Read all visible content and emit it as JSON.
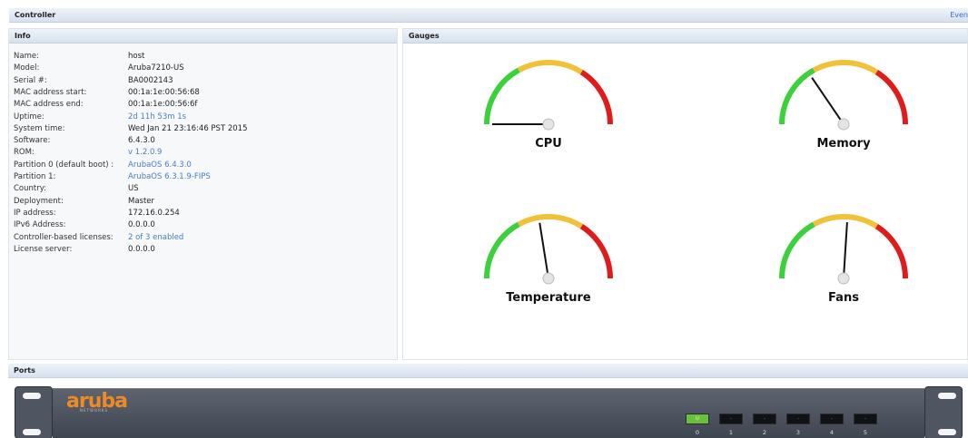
{
  "header": {
    "title": "Controller",
    "events_link": "Even"
  },
  "info": {
    "title": "Info",
    "rows": [
      {
        "label": "Name:",
        "value": "host",
        "link": false
      },
      {
        "label": "Model:",
        "value": "Aruba7210-US",
        "link": false
      },
      {
        "label": "Serial #:",
        "value": "BA0002143",
        "link": false
      },
      {
        "label": "MAC address start:",
        "value": "00:1a:1e:00:56:68",
        "link": false
      },
      {
        "label": "MAC address end:",
        "value": "00:1a:1e:00:56:6f",
        "link": false
      },
      {
        "label": "Uptime:",
        "value": "2d 11h 53m 1s",
        "link": true
      },
      {
        "label": "System time:",
        "value": "Wed Jan 21 23:16:46 PST 2015",
        "link": false
      },
      {
        "label": "Software:",
        "value": "6.4.3.0",
        "link": false
      },
      {
        "label": "ROM:",
        "value": "v 1.2.0.9",
        "link": true
      },
      {
        "label": "Partition 0 (default boot) :",
        "value": "ArubaOS 6.4.3.0",
        "link": true
      },
      {
        "label": "Partition 1:",
        "value": "ArubaOS 6.3.1.9-FIPS",
        "link": true
      },
      {
        "label": "Country:",
        "value": "US",
        "link": false
      },
      {
        "label": "Deployment:",
        "value": "Master",
        "link": false
      },
      {
        "label": "IP address:",
        "value": "172.16.0.254",
        "link": false
      },
      {
        "label": "IPv6 Address:",
        "value": "0.0.0.0",
        "link": false
      },
      {
        "label": "Controller-based licenses:",
        "value": "2 of 3 enabled",
        "link": true
      },
      {
        "label": "License server:",
        "value": "0.0.0.0",
        "link": false
      }
    ]
  },
  "gauges": {
    "title": "Gauges",
    "items": [
      {
        "label": "CPU",
        "level": 0.0
      },
      {
        "label": "Memory",
        "level": 0.31
      },
      {
        "label": "Temperature",
        "level": 0.45
      },
      {
        "label": "Fans",
        "level": 0.52
      }
    ],
    "colors": {
      "green": "#3bd13b",
      "yellow": "#f2c13a",
      "red": "#e01b1b"
    }
  },
  "ports": {
    "title": "Ports",
    "brand": "aruba",
    "brand_sub": "NETWORKS",
    "items": [
      {
        "num": "0",
        "status": "U",
        "up": true
      },
      {
        "num": "1",
        "status": "-",
        "up": false
      },
      {
        "num": "2",
        "status": "-",
        "up": false
      },
      {
        "num": "3",
        "status": "-",
        "up": false
      },
      {
        "num": "4",
        "status": "-",
        "up": false
      },
      {
        "num": "5",
        "status": "-",
        "up": false
      }
    ]
  }
}
